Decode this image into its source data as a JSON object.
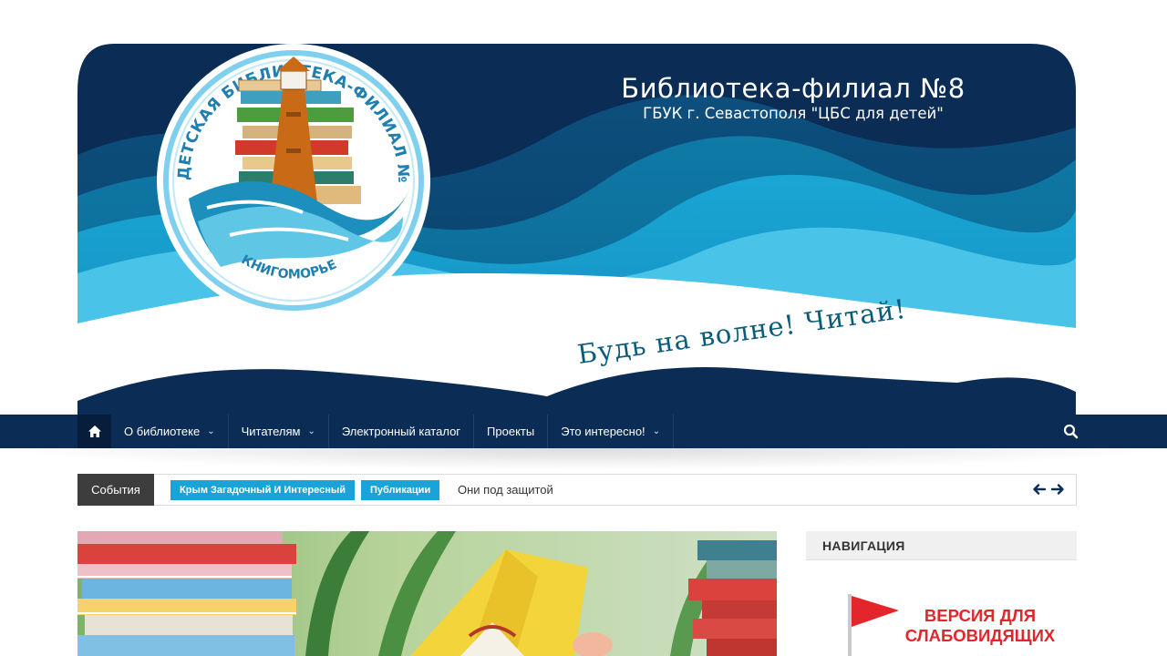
{
  "header": {
    "title": "Библиотека-филиал №8",
    "subtitle": "ГБУК г. Севастополя \"ЦБС для детей\"",
    "slogan": "Будь на волне! Читай!",
    "logo": {
      "ring_text": "ДЕТСКАЯ БИБЛИОТЕКА-ФИЛИАЛ №8",
      "bottom_text": "КНИГОМОРЬЕ"
    }
  },
  "nav": {
    "home_icon": "home-icon",
    "items": [
      {
        "label": "О библиотеке",
        "has_dropdown": true
      },
      {
        "label": "Читателям",
        "has_dropdown": true
      },
      {
        "label": "Электронный каталог",
        "has_dropdown": false
      },
      {
        "label": "Проекты",
        "has_dropdown": false
      },
      {
        "label": "Это интересно!",
        "has_dropdown": true
      }
    ],
    "search_icon": "search-icon"
  },
  "ticker": {
    "label": "События",
    "tags": [
      "Крым Загадочный И Интересный",
      "Публикации"
    ],
    "headline": "Они под защитой"
  },
  "sidebar": {
    "heading": "НАВИГАЦИЯ",
    "vision_lines": [
      "ВЕРСИЯ ДЛЯ",
      "СЛАБОВИДЯЩИХ"
    ]
  },
  "colors": {
    "navy": "#0b2c55",
    "accent_blue": "#1aa3d9",
    "vision_red": "#e2262b",
    "slogan": "#0a5d7a"
  }
}
